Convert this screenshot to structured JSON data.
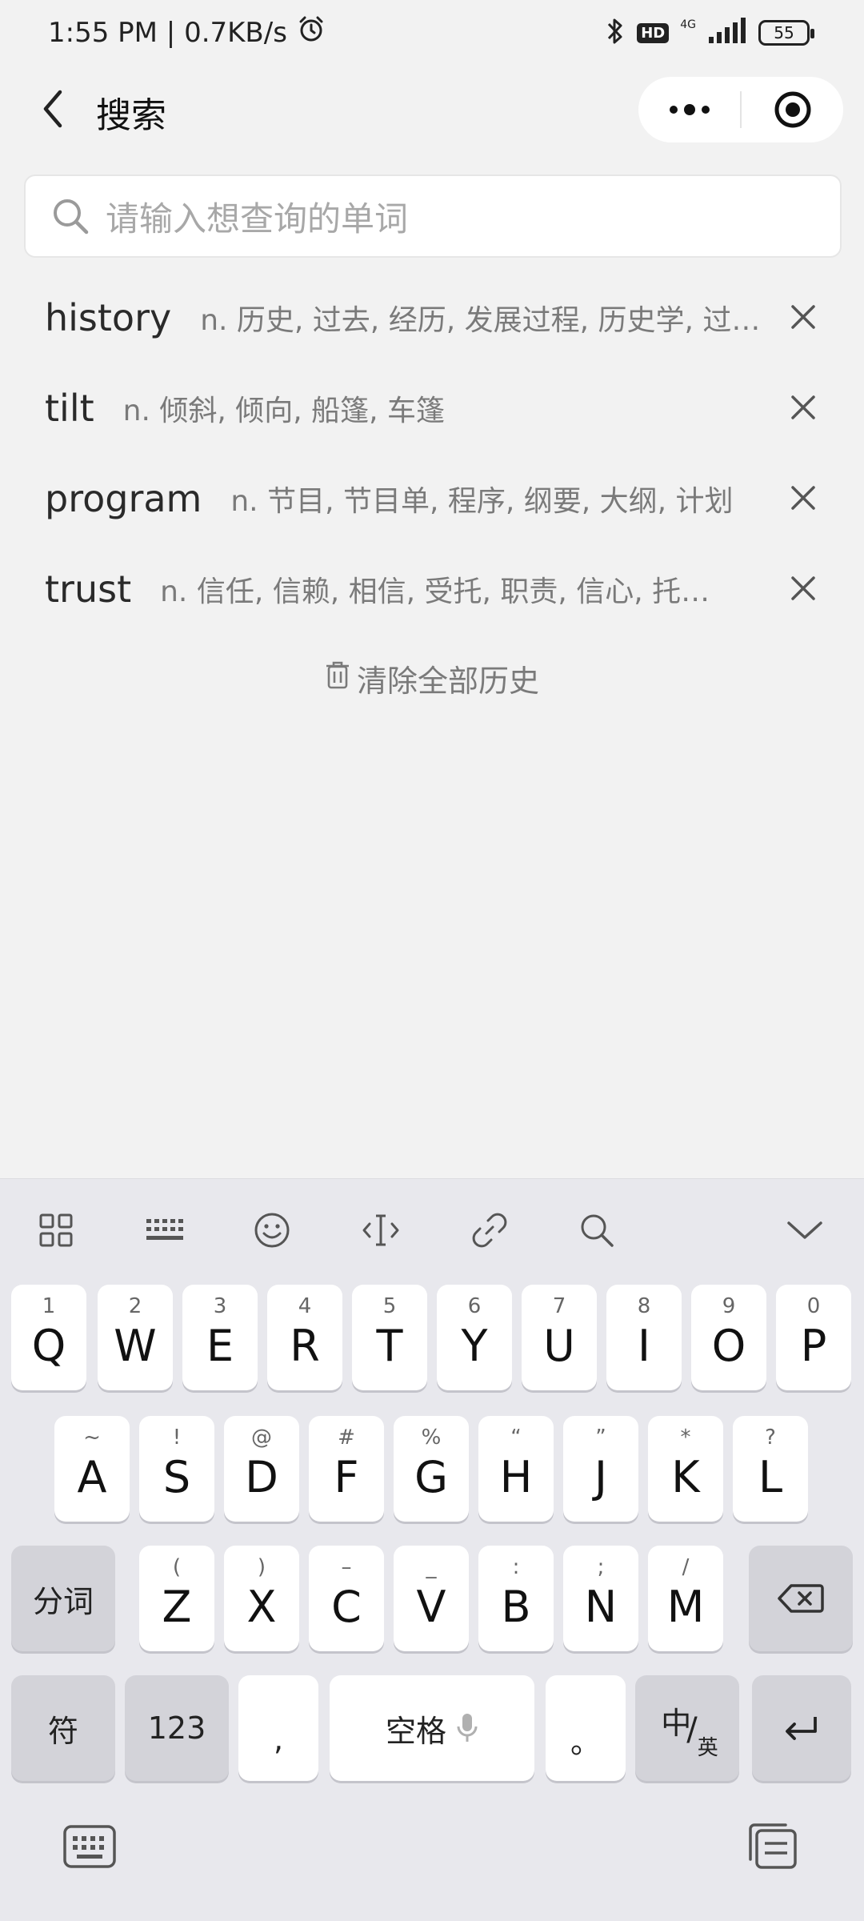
{
  "status": {
    "time_speed": "1:55 PM | 0.7KB/s",
    "hd": "HD",
    "network": "4G",
    "battery": "55"
  },
  "nav": {
    "title": "搜索"
  },
  "search": {
    "placeholder": "请输入想查询的单词"
  },
  "history": [
    {
      "word": "history",
      "definition": "n. 历史, 过去, 经历, 发展过程, 历史学, 过…"
    },
    {
      "word": "tilt",
      "definition": "n. 倾斜, 倾向, 船篷, 车篷"
    },
    {
      "word": "program",
      "definition": "n. 节目, 节目单, 程序, 纲要, 大纲, 计划"
    },
    {
      "word": "trust",
      "definition": "n. 信任, 信赖, 相信, 受托, 职责, 信心, 托拉斯"
    }
  ],
  "clear_all": "清除全部历史",
  "keyboard": {
    "row1": [
      {
        "main": "Q",
        "sub": "1"
      },
      {
        "main": "W",
        "sub": "2"
      },
      {
        "main": "E",
        "sub": "3"
      },
      {
        "main": "R",
        "sub": "4"
      },
      {
        "main": "T",
        "sub": "5"
      },
      {
        "main": "Y",
        "sub": "6"
      },
      {
        "main": "U",
        "sub": "7"
      },
      {
        "main": "I",
        "sub": "8"
      },
      {
        "main": "O",
        "sub": "9"
      },
      {
        "main": "P",
        "sub": "0"
      }
    ],
    "row2": [
      {
        "main": "A",
        "sub": "~"
      },
      {
        "main": "S",
        "sub": "!"
      },
      {
        "main": "D",
        "sub": "@"
      },
      {
        "main": "F",
        "sub": "#"
      },
      {
        "main": "G",
        "sub": "%"
      },
      {
        "main": "H",
        "sub": "“"
      },
      {
        "main": "J",
        "sub": "”"
      },
      {
        "main": "K",
        "sub": "*"
      },
      {
        "main": "L",
        "sub": "?"
      }
    ],
    "row3": [
      {
        "main": "Z",
        "sub": "("
      },
      {
        "main": "X",
        "sub": ")"
      },
      {
        "main": "C",
        "sub": "–"
      },
      {
        "main": "V",
        "sub": "_"
      },
      {
        "main": "B",
        "sub": ":"
      },
      {
        "main": "N",
        "sub": ";"
      },
      {
        "main": "M",
        "sub": "/"
      }
    ],
    "fenci": "分词",
    "symbols": "符",
    "numbers": "123",
    "comma": ",",
    "space": "空格",
    "period": "。",
    "lang_main": "中",
    "lang_slash": "/",
    "lang_sub": "英"
  }
}
